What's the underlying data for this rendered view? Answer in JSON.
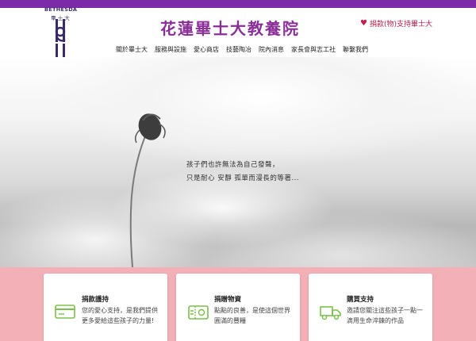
{
  "brand": {
    "logo_text": "BETHESDA",
    "logo_sub": "畢 士 大",
    "site_title": "花蓮畢士大教養院"
  },
  "header": {
    "donate_link": "捐款(物)支持畢士大"
  },
  "nav": {
    "items": [
      "關於畢士大",
      "服務與設施",
      "愛心商店",
      "技藝陶冶",
      "院內消息",
      "家長會與志工社",
      "聯繫我們"
    ]
  },
  "hero": {
    "line1": "孩子們也許無法為自己發聲，",
    "line2": "只是耐心 安靜 孤單而漫長的等著..."
  },
  "cards": [
    {
      "title": "捐款護持",
      "text": "您的愛心支持，是我們提供更多愛給這些孩子的力量!",
      "icon": "credit-card-icon"
    },
    {
      "title": "捐贈物資",
      "text": "點點的良善，是使這個世界圓滿的豐糧",
      "icon": "gift-voucher-icon"
    },
    {
      "title": "購買支持",
      "text": "邀請您關注這些孩子一點一滴用生命淬鍊的作品",
      "icon": "delivery-truck-icon"
    }
  ],
  "colors": {
    "topbar": "#7d2aa8",
    "title": "#8b2f98",
    "accent_pink": "#f3b1b7",
    "icon_green": "#7cc04a"
  }
}
